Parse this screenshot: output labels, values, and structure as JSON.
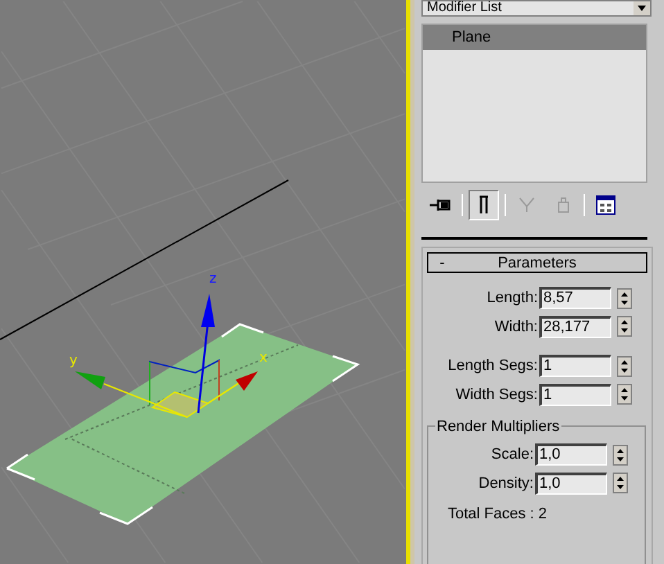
{
  "viewport": {
    "axis_labels": [
      {
        "text": "z"
      },
      {
        "text": "y"
      },
      {
        "text": "x"
      }
    ]
  },
  "modifier_list": {
    "value": "Modifier List"
  },
  "stack": [
    {
      "label": "Plane",
      "selected": true
    }
  ],
  "stack_toolbar": [
    {
      "kind": "pin",
      "pressed": false,
      "disabled": false
    },
    {
      "kind": "end-result",
      "pressed": true,
      "disabled": false
    },
    {
      "kind": "unique",
      "pressed": false,
      "disabled": true
    },
    {
      "kind": "remove",
      "pressed": false,
      "disabled": true
    },
    {
      "kind": "configure",
      "pressed": false,
      "disabled": false
    }
  ],
  "parameters": {
    "collapse_sign": "-",
    "title": "Parameters",
    "fields": [
      {
        "label": "Length:",
        "value": "8,57"
      },
      {
        "label": "Width:",
        "value": "28,177"
      }
    ],
    "segment_fields": [
      {
        "label": "Length Segs:",
        "value": "1"
      },
      {
        "label": "Width Segs:",
        "value": "1"
      }
    ],
    "render_multipliers": {
      "title": "Render Multipliers",
      "fields": [
        {
          "label": "Scale:",
          "value": "1,0"
        },
        {
          "label": "Density:",
          "value": "1,0"
        }
      ],
      "total_faces": "Total Faces : 2"
    }
  }
}
